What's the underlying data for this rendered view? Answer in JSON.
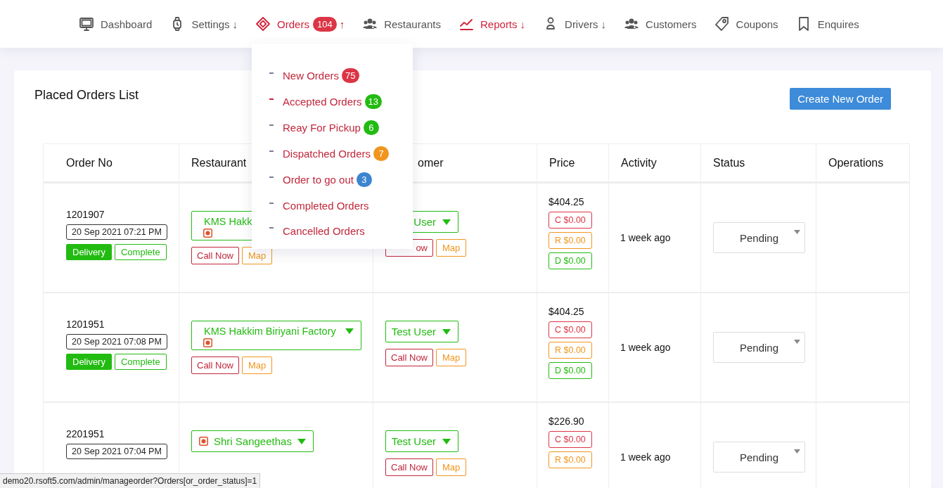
{
  "nav": [
    {
      "label": "Dashboard",
      "highlighted": false
    },
    {
      "label": "Settings",
      "highlighted": false,
      "arrow": "↓"
    },
    {
      "label": "Orders",
      "highlighted": true,
      "badge": "104",
      "arrow": "↑"
    },
    {
      "label": "Restaurants",
      "highlighted": false
    },
    {
      "label": "Reports",
      "highlighted": true,
      "arrow": "↓"
    },
    {
      "label": "Drivers",
      "highlighted": false,
      "arrow": "↓"
    },
    {
      "label": "Customers",
      "highlighted": false
    },
    {
      "label": "Coupons",
      "highlighted": false
    },
    {
      "label": "Enquires",
      "highlighted": false
    }
  ],
  "orders_menu": [
    {
      "label": "New Orders",
      "selected": false,
      "badge": "75",
      "color": "#dc3545"
    },
    {
      "label": "Accepted Orders",
      "selected": true,
      "badge": "13",
      "color": "#22bb11"
    },
    {
      "label": "Reay For Pickup",
      "selected": false,
      "badge": "6",
      "color": "#22bb11"
    },
    {
      "label": "Dispatched Orders",
      "selected": false,
      "badge": "7",
      "color": "#f0961e"
    },
    {
      "label": "Order to go out",
      "selected": false,
      "badge": "3",
      "color": "#3d85d0"
    },
    {
      "label": "Completed Orders",
      "selected": false
    },
    {
      "label": "Cancelled Orders",
      "selected": false
    }
  ],
  "page": {
    "title": "Placed Orders List",
    "create_button": "Create New Order"
  },
  "table": {
    "columns": [
      "Order No",
      "Restaurant",
      "omer",
      "Price",
      "Activity",
      "Status",
      "Operations"
    ],
    "rows": [
      {
        "order_no": "1201907",
        "date": "20 Sep 2021 07:21 PM",
        "order_buttons": [
          "Delivery",
          "Complete"
        ],
        "restaurant": {
          "name": "KMS Hakk",
          "kind": "stacked",
          "buttons": [
            "Call Now",
            "Map"
          ]
        },
        "customer": {
          "name": "User",
          "call": "ow",
          "map": "Map"
        },
        "price": "$404.25",
        "charges": [
          {
            "label": "C $0.00",
            "color": "#dc3545"
          },
          {
            "label": "R $0.00",
            "color": "#f0961e"
          },
          {
            "label": "D $0.00",
            "color": "#22bb11"
          }
        ],
        "activity": "1 week ago",
        "status": "Pending"
      },
      {
        "order_no": "1201951",
        "date": "20 Sep 2021 07:08 PM",
        "order_buttons": [
          "Delivery",
          "Complete"
        ],
        "restaurant": {
          "name": "KMS Hakkim Biriyani Factory",
          "kind": "stacked",
          "caret": true,
          "buttons": [
            "Call Now",
            "Map"
          ]
        },
        "customer": {
          "name": "Test User",
          "call": "Call Now",
          "map": "Map"
        },
        "price": "$404.25",
        "charges": [
          {
            "label": "C $0.00",
            "color": "#dc3545"
          },
          {
            "label": "R $0.00",
            "color": "#f0961e"
          },
          {
            "label": "D $0.00",
            "color": "#22bb11"
          }
        ],
        "activity": "1 week ago",
        "status": "Pending"
      },
      {
        "order_no": "2201951",
        "date": "20 Sep 2021 07:04 PM",
        "restaurant": {
          "name": "Shri Sangeethas",
          "kind": "inline",
          "caret": true
        },
        "customer": {
          "name": "Test User",
          "call": "Call Now",
          "map": "Map"
        },
        "price": "$226.90",
        "charges": [
          {
            "label": "C $0.00",
            "color": "#dc3545"
          },
          {
            "label": "R $0.00",
            "color": "#f0961e"
          }
        ],
        "activity": "1 week ago",
        "status": "Pending"
      }
    ]
  },
  "status_bar": {
    "url": "demo20.rsoft5.com/admin/manageorder?Orders[or_order_status]=1"
  }
}
